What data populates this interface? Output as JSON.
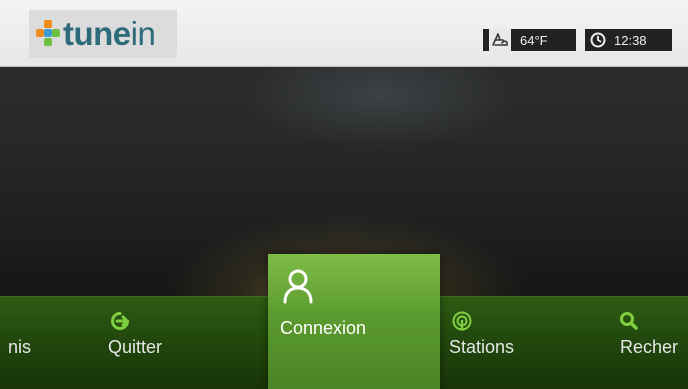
{
  "app": {
    "logo_text_bold": "tune",
    "logo_text_light": "in"
  },
  "status": {
    "temperature": "64°F",
    "time": "12:38",
    "weather_icon": "weather-icon",
    "clock_icon": "clock-icon"
  },
  "menu": {
    "items": [
      {
        "label": "nis",
        "icon": "none",
        "selected": false
      },
      {
        "label": "Quitter",
        "icon": "exit-icon",
        "selected": false
      },
      {
        "label": "Connexion",
        "icon": "user-icon",
        "selected": true
      },
      {
        "label": "Stations",
        "icon": "radio-tower-icon",
        "selected": false
      },
      {
        "label": "Recher",
        "icon": "search-icon",
        "selected": false
      }
    ]
  },
  "colors": {
    "accent_green": "#6cbf3f",
    "selected_tile": "#5c9b2f",
    "menu_bar": "#234a0e"
  }
}
